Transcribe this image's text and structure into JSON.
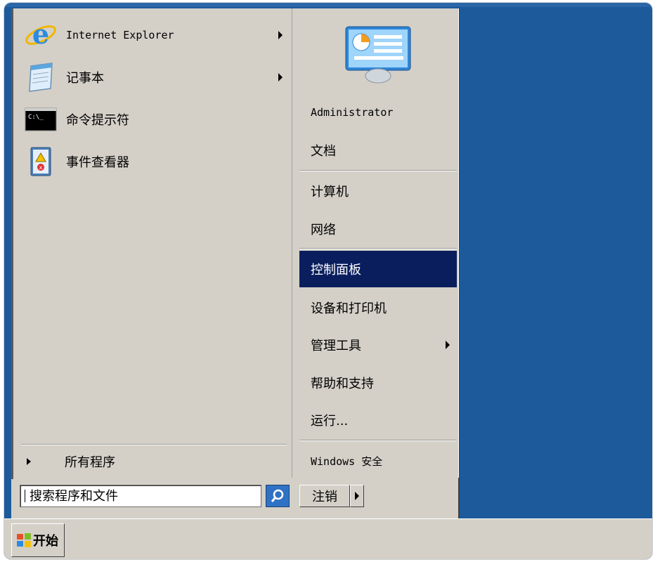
{
  "programs": [
    {
      "label": "Internet Explorer",
      "has_submenu": true,
      "icon": "internet-explorer-icon"
    },
    {
      "label": "记事本",
      "has_submenu": true,
      "icon": "notepad-icon"
    },
    {
      "label": "命令提示符",
      "has_submenu": false,
      "icon": "command-prompt-icon",
      "icon_text": "C:\\_"
    },
    {
      "label": "事件查看器",
      "has_submenu": false,
      "icon": "event-viewer-icon"
    }
  ],
  "all_programs": "所有程序",
  "search": {
    "placeholder": "搜索程序和文件"
  },
  "right": {
    "user": "Administrator",
    "documents": "文档",
    "computer": "计算机",
    "network": "网络",
    "control_panel": "控制面板",
    "devices_printers": "设备和打印机",
    "admin_tools": "管理工具",
    "help_support": "帮助和支持",
    "run": "运行...",
    "windows_security": "Windows 安全"
  },
  "logoff": "注销",
  "taskbar": {
    "start": "开始"
  },
  "colors": {
    "desktop": "#1d5a9c",
    "menu": "#d4d0c8",
    "selected": "#0a1e5e",
    "search_button": "#2f72c4"
  }
}
